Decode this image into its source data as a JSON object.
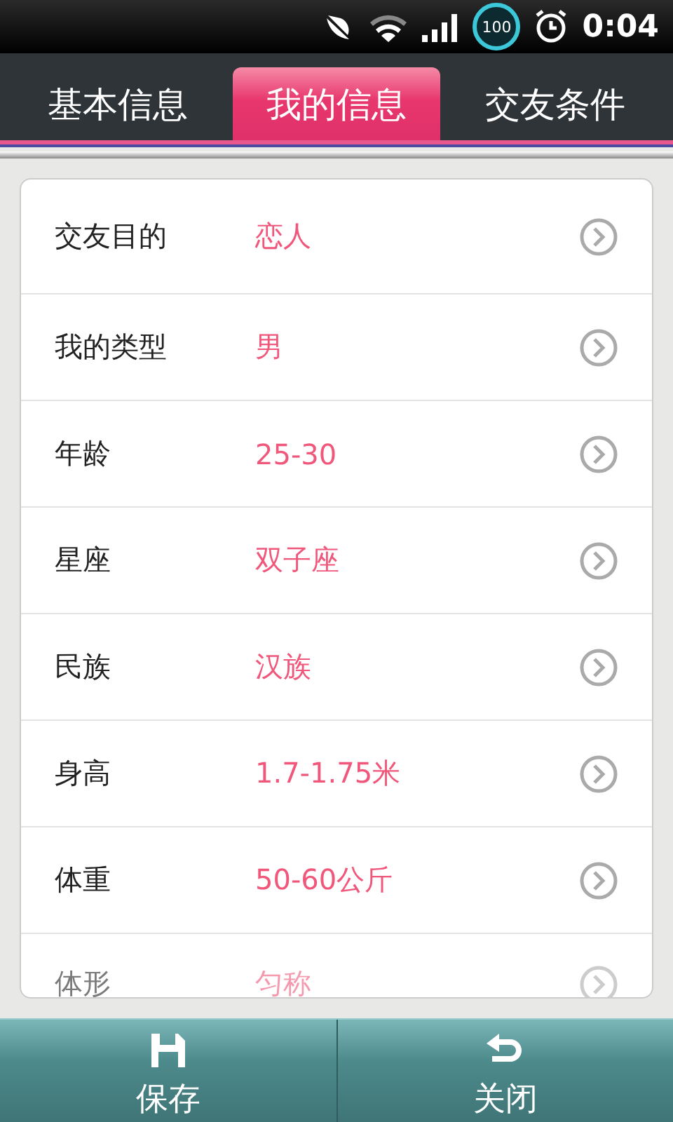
{
  "status_bar": {
    "battery": "100",
    "time": "0:04"
  },
  "tabs": [
    {
      "label": "基本信息",
      "selected": false
    },
    {
      "label": "我的信息",
      "selected": true
    },
    {
      "label": "交友条件",
      "selected": false
    }
  ],
  "rows": [
    {
      "label": "交友目的",
      "value": "恋人"
    },
    {
      "label": "我的类型",
      "value": "男"
    },
    {
      "label": "年龄",
      "value": "25-30"
    },
    {
      "label": "星座",
      "value": "双子座"
    },
    {
      "label": "民族",
      "value": "汉族"
    },
    {
      "label": "身高",
      "value": "1.7-1.75米"
    },
    {
      "label": "体重",
      "value": "50-60公斤"
    },
    {
      "label": "体形",
      "value": "匀称"
    }
  ],
  "bottom_bar": [
    {
      "kind": "save",
      "label": "保存"
    },
    {
      "kind": "close",
      "label": "关闭"
    }
  ]
}
